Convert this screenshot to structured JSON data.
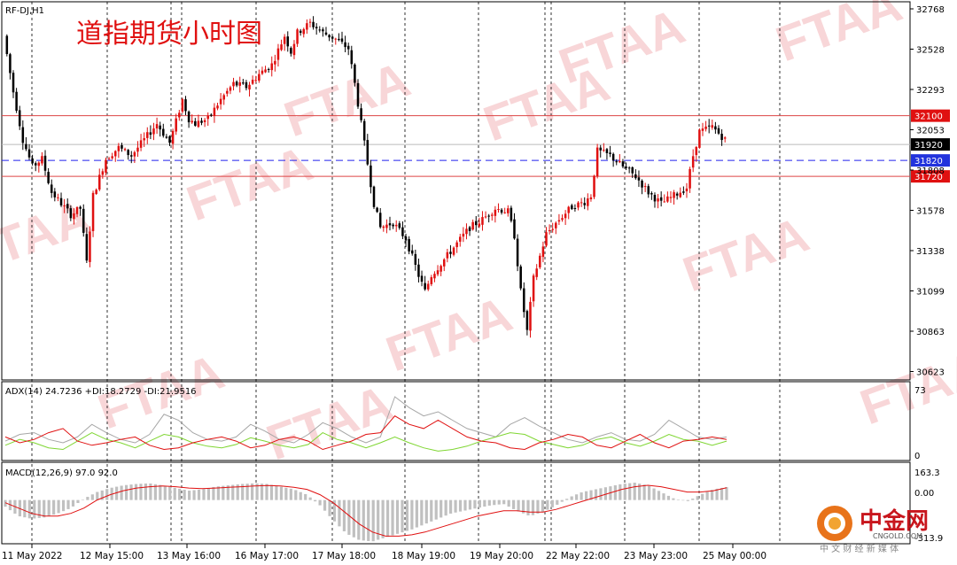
{
  "symbol_label": "RF-DJ,H1",
  "title": "道指期货小时图",
  "watermark": "FTAA",
  "price_axis": {
    "ticks": [
      "32768",
      "32528",
      "32293",
      "32053",
      "31808",
      "31578",
      "31338",
      "31099",
      "30863",
      "30623"
    ],
    "levels": [
      {
        "price": 32100,
        "label": "32100",
        "style": "red-line"
      },
      {
        "price": 31920,
        "label": "31920",
        "style": "current"
      },
      {
        "price": 31820,
        "label": "31820",
        "style": "blue-dashed"
      },
      {
        "price": 31720,
        "label": "31720",
        "style": "red-line"
      }
    ]
  },
  "time_axis": [
    "11 May 2022",
    "12 May 15:00",
    "13 May 16:00",
    "16 May 17:00",
    "17 May 18:00",
    "18 May 19:00",
    "19 May 20:00",
    "22 May 22:00",
    "23 May 23:00",
    "25 May 00:00"
  ],
  "adx_panel": {
    "label": "ADX(14) 24.7236 +DI:18.2729 -DI:21.9516",
    "ticks": [
      "73",
      "0"
    ],
    "colors": {
      "adx": "#a6a6a6",
      "plus_di": "#7fd632",
      "minus_di": "#e01010"
    }
  },
  "macd_panel": {
    "label": "MACD(12,26,9) 97.0 92.0",
    "ticks": [
      "163.3",
      "0.00",
      "-313.9"
    ],
    "colors": {
      "histogram": "#c0c0c0",
      "signal": "#e01010"
    }
  },
  "logo": {
    "name": "中金网",
    "url": "CNGOLD.COM",
    "tagline": "中 文 财 经 新 媒 体"
  },
  "colors": {
    "bull": "#e01010",
    "bear": "#000000",
    "level_red": "#d44",
    "level_blue": "#2222ee",
    "grid": "#000000"
  },
  "chart_data": [
    {
      "type": "candlestick",
      "title": "道指期货小时图",
      "series_label": "RF-DJ,H1",
      "y_ticks": [
        32768,
        32528,
        32293,
        32053,
        31808,
        31578,
        31338,
        31099,
        30863,
        30623
      ],
      "ylim": [
        30540,
        32780
      ],
      "x_ticks": [
        "11 May 2022",
        "12 May 15:00",
        "13 May 16:00",
        "16 May 17:00",
        "17 May 18:00",
        "18 May 19:00",
        "19 May 20:00",
        "22 May 22:00",
        "23 May 23:00",
        "25 May 00:00"
      ],
      "reference_levels": [
        32100,
        31920,
        31820,
        31720
      ],
      "close_path": [
        [
          0,
          32600
        ],
        [
          3,
          32250
        ],
        [
          6,
          31950
        ],
        [
          9,
          31780
        ],
        [
          12,
          31830
        ],
        [
          15,
          31620
        ],
        [
          18,
          31550
        ],
        [
          21,
          31480
        ],
        [
          24,
          31520
        ],
        [
          26,
          31180
        ],
        [
          28,
          31600
        ],
        [
          32,
          31830
        ],
        [
          36,
          31900
        ],
        [
          40,
          31850
        ],
        [
          44,
          31950
        ],
        [
          48,
          32050
        ],
        [
          52,
          31930
        ],
        [
          56,
          32200
        ],
        [
          58,
          32080
        ],
        [
          60,
          32050
        ],
        [
          64,
          32080
        ],
        [
          68,
          32200
        ],
        [
          72,
          32300
        ],
        [
          76,
          32280
        ],
        [
          80,
          32360
        ],
        [
          84,
          32420
        ],
        [
          88,
          32600
        ],
        [
          90,
          32500
        ],
        [
          92,
          32620
        ],
        [
          96,
          32680
        ],
        [
          100,
          32620
        ],
        [
          104,
          32580
        ],
        [
          108,
          32520
        ],
        [
          110,
          32300
        ],
        [
          112,
          32050
        ],
        [
          114,
          31800
        ],
        [
          116,
          31550
        ],
        [
          118,
          31400
        ],
        [
          122,
          31430
        ],
        [
          126,
          31330
        ],
        [
          130,
          31100
        ],
        [
          132,
          31000
        ],
        [
          134,
          31100
        ],
        [
          138,
          31200
        ],
        [
          142,
          31300
        ],
        [
          146,
          31400
        ],
        [
          150,
          31450
        ],
        [
          154,
          31520
        ],
        [
          158,
          31500
        ],
        [
          160,
          31350
        ],
        [
          162,
          31000
        ],
        [
          164,
          30750
        ],
        [
          166,
          31080
        ],
        [
          170,
          31360
        ],
        [
          174,
          31450
        ],
        [
          178,
          31530
        ],
        [
          182,
          31560
        ],
        [
          184,
          31600
        ],
        [
          186,
          31880
        ],
        [
          190,
          31850
        ],
        [
          194,
          31780
        ],
        [
          198,
          31720
        ],
        [
          202,
          31620
        ],
        [
          206,
          31550
        ],
        [
          210,
          31600
        ],
        [
          214,
          31650
        ],
        [
          216,
          31850
        ],
        [
          218,
          32000
        ],
        [
          222,
          32030
        ],
        [
          226,
          31950
        ]
      ]
    },
    {
      "type": "line",
      "title": "ADX(14)",
      "ylim": [
        0,
        73
      ],
      "series": [
        {
          "name": "ADX",
          "values": [
            20,
            28,
            30,
            22,
            18,
            25,
            40,
            30,
            22,
            18,
            28,
            52,
            45,
            30,
            22,
            20,
            25,
            40,
            32,
            22,
            18,
            28,
            42,
            35,
            25,
            18,
            25,
            73,
            60,
            50,
            55,
            45,
            35,
            30,
            25,
            40,
            48,
            38,
            30,
            22,
            18,
            25,
            30,
            22,
            20,
            28,
            45,
            35,
            25,
            22,
            25
          ]
        },
        {
          "name": "+DI",
          "values": [
            15,
            22,
            18,
            12,
            10,
            20,
            30,
            22,
            18,
            12,
            20,
            28,
            25,
            18,
            14,
            12,
            16,
            24,
            20,
            15,
            12,
            16,
            30,
            22,
            18,
            12,
            18,
            25,
            18,
            12,
            8,
            10,
            14,
            20,
            25,
            30,
            28,
            20,
            16,
            12,
            15,
            22,
            25,
            18,
            14,
            20,
            28,
            22,
            20,
            15,
            20
          ]
        },
        {
          "name": "-DI",
          "values": [
            25,
            18,
            22,
            30,
            35,
            20,
            15,
            18,
            22,
            25,
            15,
            10,
            12,
            18,
            22,
            25,
            20,
            12,
            15,
            22,
            25,
            20,
            10,
            15,
            20,
            28,
            30,
            50,
            40,
            35,
            45,
            35,
            25,
            20,
            18,
            12,
            10,
            18,
            22,
            28,
            25,
            15,
            12,
            20,
            28,
            18,
            12,
            20,
            22,
            25,
            22
          ]
        }
      ]
    },
    {
      "type": "bar",
      "title": "MACD(12,26,9)",
      "ylim": [
        -313.9,
        163.3
      ],
      "series": [
        {
          "name": "MACD",
          "values": [
            -50,
            -120,
            -140,
            -130,
            -100,
            -60,
            10,
            60,
            90,
            110,
            120,
            125,
            110,
            90,
            70,
            80,
            100,
            110,
            120,
            125,
            120,
            100,
            80,
            40,
            -40,
            -150,
            -250,
            -300,
            -310,
            -280,
            -250,
            -220,
            -180,
            -140,
            -100,
            -80,
            -60,
            -40,
            -30,
            -80,
            -120,
            -90,
            -40,
            20,
            60,
            80,
            100,
            120,
            130,
            110,
            60,
            10,
            -10,
            40,
            80,
            97
          ]
        },
        {
          "name": "Signal",
          "values": [
            -20,
            -60,
            -100,
            -120,
            -120,
            -100,
            -60,
            0,
            40,
            70,
            90,
            100,
            105,
            100,
            90,
            85,
            90,
            95,
            100,
            105,
            108,
            105,
            95,
            80,
            40,
            -20,
            -100,
            -180,
            -240,
            -270,
            -270,
            -260,
            -240,
            -210,
            -180,
            -150,
            -120,
            -100,
            -80,
            -80,
            -90,
            -90,
            -70,
            -40,
            -10,
            20,
            50,
            80,
            100,
            110,
            100,
            80,
            60,
            60,
            70,
            92
          ]
        }
      ]
    }
  ]
}
